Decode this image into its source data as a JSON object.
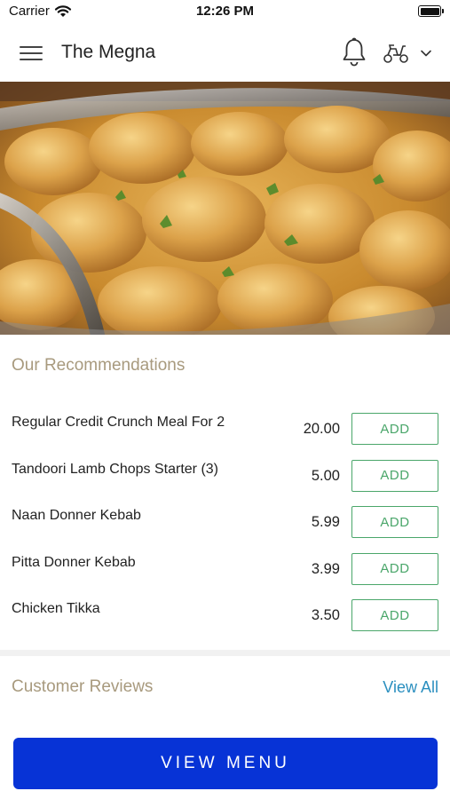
{
  "status_bar": {
    "carrier": "Carrier",
    "time": "12:26 PM"
  },
  "header": {
    "title": "The Megna",
    "icons": {
      "menu": "hamburger-icon",
      "notifications": "bell-icon",
      "order_mode": "scooter-icon",
      "expand": "chevron-down-icon"
    }
  },
  "hero": {
    "image": "curry-dish-photo"
  },
  "recommendations": {
    "title": "Our Recommendations",
    "add_label": "ADD",
    "items": [
      {
        "name": "Regular Credit Crunch Meal For 2",
        "price": "20.00"
      },
      {
        "name": "Tandoori Lamb Chops Starter (3)",
        "price": "5.00"
      },
      {
        "name": "Naan Donner Kebab",
        "price": "5.99"
      },
      {
        "name": "Pitta Donner Kebab",
        "price": "3.99"
      },
      {
        "name": "Chicken Tikka",
        "price": "3.50"
      }
    ]
  },
  "reviews": {
    "title": "Customer Reviews",
    "view_all": "View All"
  },
  "cta": {
    "label": "VIEW MENU"
  },
  "colors": {
    "accent_blue": "#0733d6",
    "add_green": "#4aa66a",
    "section_title": "#a89a7e",
    "link_blue": "#2b8fbf"
  }
}
